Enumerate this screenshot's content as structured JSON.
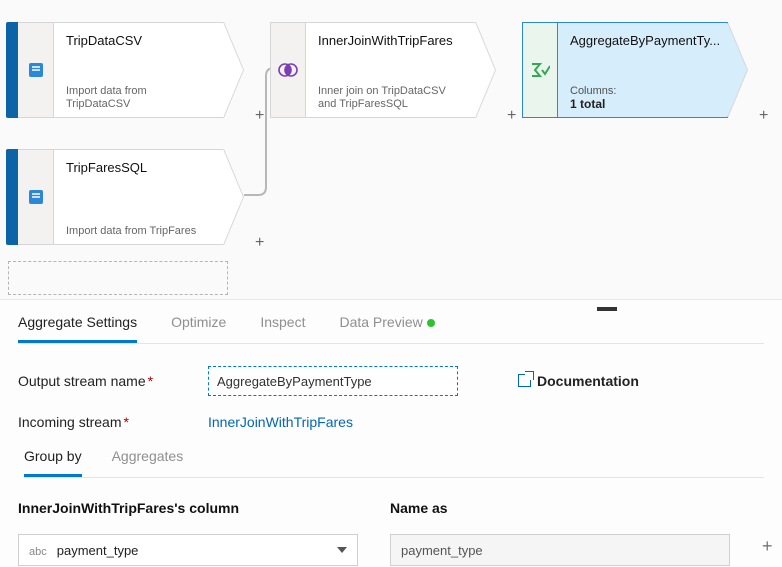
{
  "canvas": {
    "nodes": {
      "tripdata": {
        "title": "TripDataCSV",
        "desc": "Import data from TripDataCSV"
      },
      "tripfares": {
        "title": "TripFaresSQL",
        "desc": "Import data from TripFares"
      },
      "join": {
        "title": "InnerJoinWithTripFares",
        "desc": "Inner join on TripDataCSV and TripFaresSQL"
      },
      "agg": {
        "title": "AggregateByPaymentTy...",
        "colsLabel": "Columns:",
        "colsValue": "1 total"
      }
    }
  },
  "panel": {
    "tabs": {
      "aggSettings": "Aggregate Settings",
      "optimize": "Optimize",
      "inspect": "Inspect",
      "dataPreview": "Data Preview"
    },
    "fields": {
      "outputStreamLabel": "Output stream name",
      "outputStreamValue": "AggregateByPaymentType",
      "incomingLabel": "Incoming stream",
      "incomingValue": "InnerJoinWithTripFares",
      "docLink": "Documentation"
    },
    "subtabs": {
      "groupBy": "Group by",
      "aggregates": "Aggregates"
    },
    "groupBy": {
      "columnHeader": "InnerJoinWithTripFares's column",
      "nameAsHeader": "Name as",
      "columnPrefix": "abc",
      "columnValue": "payment_type",
      "nameValue": "payment_type"
    }
  }
}
